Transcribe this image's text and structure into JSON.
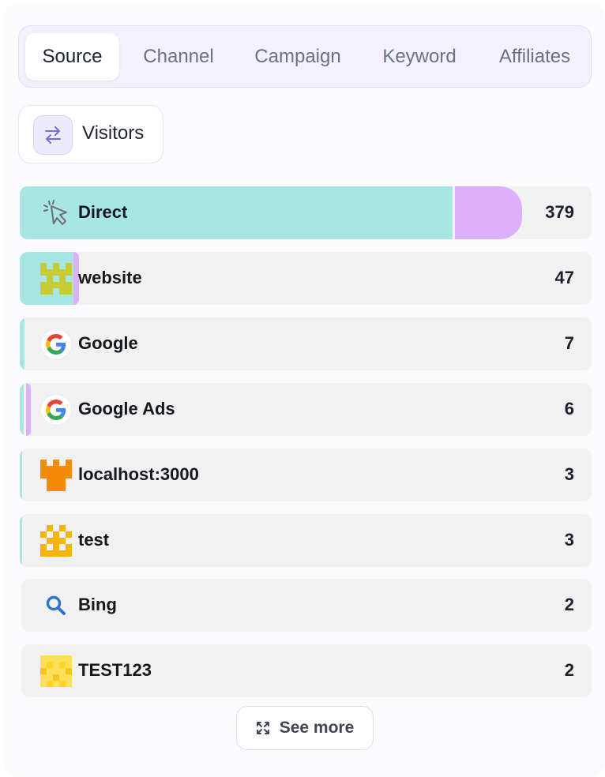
{
  "tabs": [
    {
      "label": "Source",
      "active": true
    },
    {
      "label": "Channel",
      "active": false
    },
    {
      "label": "Campaign",
      "active": false
    },
    {
      "label": "Keyword",
      "active": false
    },
    {
      "label": "Affiliates",
      "active": false
    }
  ],
  "metric": {
    "label": "Visitors",
    "icon": "swap-arrows-icon"
  },
  "sources": [
    {
      "label": "Direct",
      "value": "379",
      "icon": "cursor-click-icon",
      "share": 1.0
    },
    {
      "label": "website",
      "value": "47",
      "icon": "pixel-avatar-icon",
      "share": 0.124
    },
    {
      "label": "Google",
      "value": "7",
      "icon": "google-icon",
      "share": 0.018
    },
    {
      "label": "Google Ads",
      "value": "6",
      "icon": "google-icon",
      "share": 0.016
    },
    {
      "label": "localhost:3000",
      "value": "3",
      "icon": "pixel-avatar-icon",
      "share": 0.008
    },
    {
      "label": "test",
      "value": "3",
      "icon": "pixel-avatar-icon",
      "share": 0.008
    },
    {
      "label": "Bing",
      "value": "2",
      "icon": "search-icon",
      "share": 0.005
    },
    {
      "label": "TEST123",
      "value": "2",
      "icon": "pixel-avatar-icon",
      "share": 0.005
    }
  ],
  "see_more": {
    "label": "See more",
    "icon": "expand-icon"
  },
  "colors": {
    "bar_primary": "#a8e6e6",
    "bar_secondary": "#dcb0fb",
    "accent": "#6f6ee0"
  }
}
